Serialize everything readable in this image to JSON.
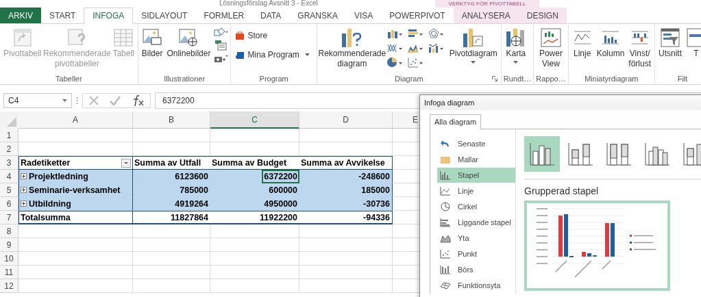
{
  "window": {
    "title": "Lösningsförslag Avsnitt 3 - Excel",
    "context_label": "VERKTYG FÖR PIVOTTABELL"
  },
  "tabs": [
    {
      "label": "ARKIV",
      "kind": "file",
      "selected": false
    },
    {
      "label": "START",
      "kind": "normal",
      "selected": false
    },
    {
      "label": "INFOGA",
      "kind": "normal",
      "selected": true
    },
    {
      "label": "SIDLAYOUT",
      "kind": "normal",
      "selected": false
    },
    {
      "label": "FORMLER",
      "kind": "normal",
      "selected": false
    },
    {
      "label": "DATA",
      "kind": "normal",
      "selected": false
    },
    {
      "label": "GRANSKA",
      "kind": "normal",
      "selected": false
    },
    {
      "label": "VISA",
      "kind": "normal",
      "selected": false
    },
    {
      "label": "POWERPIVOT",
      "kind": "normal",
      "selected": false
    },
    {
      "label": "ANALYSERA",
      "kind": "contextual",
      "selected": false
    },
    {
      "label": "DESIGN",
      "kind": "contextual",
      "selected": false
    }
  ],
  "ribbon": {
    "groups": [
      {
        "label": "Tabeller",
        "kind": "tables",
        "buttons": [
          {
            "label": "Pivottabell",
            "kind": "large",
            "disabled": true,
            "menu": false
          },
          {
            "label": "Rekommenderade pivottabeller",
            "kind": "large",
            "disabled": true,
            "menu": false
          },
          {
            "label": "Tabell",
            "kind": "large",
            "disabled": true,
            "menu": false
          }
        ]
      },
      {
        "label": "Illustrationer",
        "kind": "illustrations",
        "buttons": [
          {
            "label": "Bilder",
            "kind": "large",
            "disabled": false,
            "menu": false
          },
          {
            "label": "Onlinebilder",
            "kind": "large",
            "disabled": false,
            "menu": false
          }
        ]
      },
      {
        "label": "Program",
        "kind": "program",
        "buttons": [
          {
            "label": "Store",
            "kind": "small",
            "disabled": false,
            "menu": false
          },
          {
            "label": "Mina Program",
            "kind": "small",
            "disabled": false,
            "menu": true
          }
        ]
      },
      {
        "label": "Diagram",
        "kind": "charts",
        "buttons": [
          {
            "label": "Rekommenderade diagram",
            "kind": "large",
            "disabled": false,
            "menu": false
          },
          {
            "label": "Pivotdiagram",
            "kind": "large",
            "disabled": false,
            "menu": true
          }
        ]
      },
      {
        "label": "Rundt…",
        "kind": "map",
        "buttons": [
          {
            "label": "Karta",
            "kind": "large",
            "disabled": false,
            "menu": true
          }
        ]
      },
      {
        "label": "Rappo…",
        "kind": "report",
        "buttons": [
          {
            "label": "Power View",
            "kind": "large",
            "disabled": false,
            "menu": false
          }
        ]
      },
      {
        "label": "Miniatyrdiagram",
        "kind": "sparklines",
        "buttons": [
          {
            "label": "Linje",
            "kind": "large",
            "disabled": false,
            "menu": false
          },
          {
            "label": "Kolumn",
            "kind": "large",
            "disabled": false,
            "menu": false
          },
          {
            "label": "Vinst/ förlust",
            "kind": "large",
            "disabled": false,
            "menu": false
          }
        ]
      },
      {
        "label": "Filt",
        "kind": "filters",
        "buttons": [
          {
            "label": "Utsnitt",
            "kind": "large",
            "disabled": false,
            "menu": false
          },
          {
            "label": "T",
            "kind": "large",
            "disabled": false,
            "menu": false
          }
        ]
      }
    ]
  },
  "formula_bar": {
    "name_box": "C4",
    "formula": "6372200"
  },
  "sheet": {
    "columns": [
      {
        "label": "A",
        "selected": false
      },
      {
        "label": "B",
        "selected": false
      },
      {
        "label": "C",
        "selected": true
      },
      {
        "label": "D",
        "selected": false
      },
      {
        "label": "E",
        "selected": false
      }
    ],
    "row_numbers": [
      "1",
      "2",
      "3",
      "4",
      "5",
      "6",
      "7",
      "8",
      "9",
      "10",
      "11",
      "12"
    ]
  },
  "pivot_table": {
    "row_label": "Radetiketter",
    "columns": [
      "Summa av Utfall",
      "Summa av Budget",
      "Summa av Avvikelse"
    ],
    "rows": [
      {
        "label": "Projektledning",
        "kind": "item",
        "cells": [
          {
            "value": "6123600",
            "selected": false
          },
          {
            "value": "6372200",
            "selected": true
          },
          {
            "value": "-248600",
            "selected": false
          }
        ]
      },
      {
        "label": "Seminarie-verksamhet",
        "kind": "item",
        "cells": [
          {
            "value": "785000",
            "selected": false
          },
          {
            "value": "600000",
            "selected": false
          },
          {
            "value": "185000",
            "selected": false
          }
        ]
      },
      {
        "label": "Utbildning",
        "kind": "item",
        "cells": [
          {
            "value": "4919264",
            "selected": false
          },
          {
            "value": "4950000",
            "selected": false
          },
          {
            "value": "-30736",
            "selected": false
          }
        ]
      },
      {
        "label": "Totalsumma",
        "kind": "total",
        "cells": [
          {
            "value": "11827864",
            "selected": false
          },
          {
            "value": "11922200",
            "selected": false
          },
          {
            "value": "-94336",
            "selected": false
          }
        ]
      }
    ]
  },
  "dialog": {
    "title": "Infoga diagram",
    "tabs": [
      {
        "label": "Alla diagram",
        "selected": true
      }
    ],
    "categories": [
      {
        "label": "Senaste",
        "selected": false
      },
      {
        "label": "Mallar",
        "selected": false
      },
      {
        "label": "Stapel",
        "selected": true
      },
      {
        "label": "Linje",
        "selected": false
      },
      {
        "label": "Cirkel",
        "selected": false
      },
      {
        "label": "Liggande stapel",
        "selected": false
      },
      {
        "label": "Yta",
        "selected": false
      },
      {
        "label": "Punkt",
        "selected": false
      },
      {
        "label": "Börs",
        "selected": false
      },
      {
        "label": "Funktionsyta",
        "selected": false
      }
    ],
    "subtypes": [
      {
        "selected": true
      },
      {
        "selected": false
      },
      {
        "selected": false
      },
      {
        "selected": false
      },
      {
        "selected": false
      }
    ],
    "subtype_title": "Grupperad stapel"
  }
}
